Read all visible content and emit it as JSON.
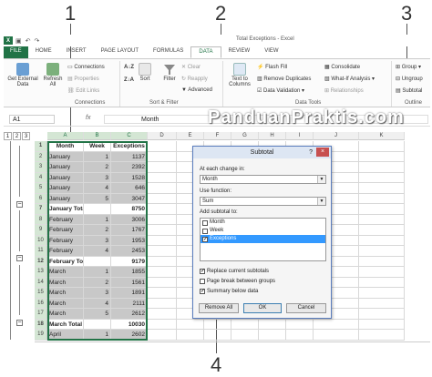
{
  "callouts": [
    "1",
    "2",
    "3",
    "4"
  ],
  "app": {
    "logo": "X",
    "window_title": "Total Exceptions - Excel"
  },
  "tabs": [
    "FILE",
    "HOME",
    "INSERT",
    "PAGE LAYOUT",
    "FORMULAS",
    "DATA",
    "REVIEW",
    "VIEW"
  ],
  "ribbon": {
    "get_external": "Get External Data",
    "refresh_all": "Refresh All",
    "connections": "Connections",
    "properties": "Properties",
    "edit_links": "Edit Links",
    "group_connections": "Connections",
    "sort": "Sort",
    "filter": "Filter",
    "clear": "Clear",
    "reapply": "Reapply",
    "advanced": "Advanced",
    "group_sort": "Sort & Filter",
    "text_to_columns": "Text to Columns",
    "flash_fill": "Flash Fill",
    "remove_duplicates": "Remove Duplicates",
    "data_validation": "Data Validation",
    "consolidate": "Consolidate",
    "what_if": "What-If Analysis",
    "relationships": "Relationships",
    "group_tools": "Data Tools",
    "group": "Group",
    "ungroup": "Ungroup",
    "subtotal": "Subtotal",
    "group_outline": "Outline"
  },
  "formula_bar": {
    "name_box": "A1",
    "fx": "fx",
    "value": "Month"
  },
  "watermark": "PanduanPraktis.com",
  "outline_levels": [
    "1",
    "2",
    "3"
  ],
  "columns": [
    "A",
    "B",
    "C",
    "D",
    "E",
    "F",
    "G",
    "H",
    "I",
    "J",
    "K"
  ],
  "rows": [
    {
      "num": "1",
      "month": "Month",
      "week": "Week",
      "exc": "Exceptions"
    },
    {
      "num": "2",
      "month": "January",
      "week": "1",
      "exc": "1137"
    },
    {
      "num": "3",
      "month": "January",
      "week": "2",
      "exc": "2392"
    },
    {
      "num": "4",
      "month": "January",
      "week": "3",
      "exc": "1528"
    },
    {
      "num": "5",
      "month": "January",
      "week": "4",
      "exc": "646"
    },
    {
      "num": "6",
      "month": "January",
      "week": "5",
      "exc": "3047"
    },
    {
      "num": "7",
      "month": "January Total",
      "week": "",
      "exc": "8750"
    },
    {
      "num": "8",
      "month": "February",
      "week": "1",
      "exc": "3006"
    },
    {
      "num": "9",
      "month": "February",
      "week": "2",
      "exc": "1767"
    },
    {
      "num": "10",
      "month": "February",
      "week": "3",
      "exc": "1953"
    },
    {
      "num": "11",
      "month": "February",
      "week": "4",
      "exc": "2453"
    },
    {
      "num": "12",
      "month": "February Total",
      "week": "",
      "exc": "9179"
    },
    {
      "num": "13",
      "month": "March",
      "week": "1",
      "exc": "1855"
    },
    {
      "num": "14",
      "month": "March",
      "week": "2",
      "exc": "1561"
    },
    {
      "num": "15",
      "month": "March",
      "week": "3",
      "exc": "1891"
    },
    {
      "num": "16",
      "month": "March",
      "week": "4",
      "exc": "2111"
    },
    {
      "num": "17",
      "month": "March",
      "week": "5",
      "exc": "2612"
    },
    {
      "num": "18",
      "month": "March Total",
      "week": "",
      "exc": "10030"
    },
    {
      "num": "19",
      "month": "April",
      "week": "1",
      "exc": "2602"
    }
  ],
  "dialog": {
    "title": "Subtotal",
    "help": "?",
    "close": "×",
    "change_label": "At each change in:",
    "change_value": "Month",
    "function_label": "Use function:",
    "function_value": "Sum",
    "add_label": "Add subtotal to:",
    "list": [
      {
        "label": "Month",
        "checked": false,
        "selected": false
      },
      {
        "label": "Week",
        "checked": false,
        "selected": false
      },
      {
        "label": "Exceptions",
        "checked": true,
        "selected": true
      }
    ],
    "replace": "Replace current subtotals",
    "page_break": "Page break between groups",
    "summary": "Summary below data",
    "remove_all": "Remove All",
    "ok": "OK",
    "cancel": "Cancel"
  },
  "icons": [
    "save-icon",
    "undo-icon",
    "redo-icon",
    "filter-icon",
    "sort-icon",
    "checkbox-icon"
  ],
  "colors": {
    "excel_green": "#217346",
    "selection_blue": "#3399ff",
    "data_gray": "#c8c8c8"
  }
}
